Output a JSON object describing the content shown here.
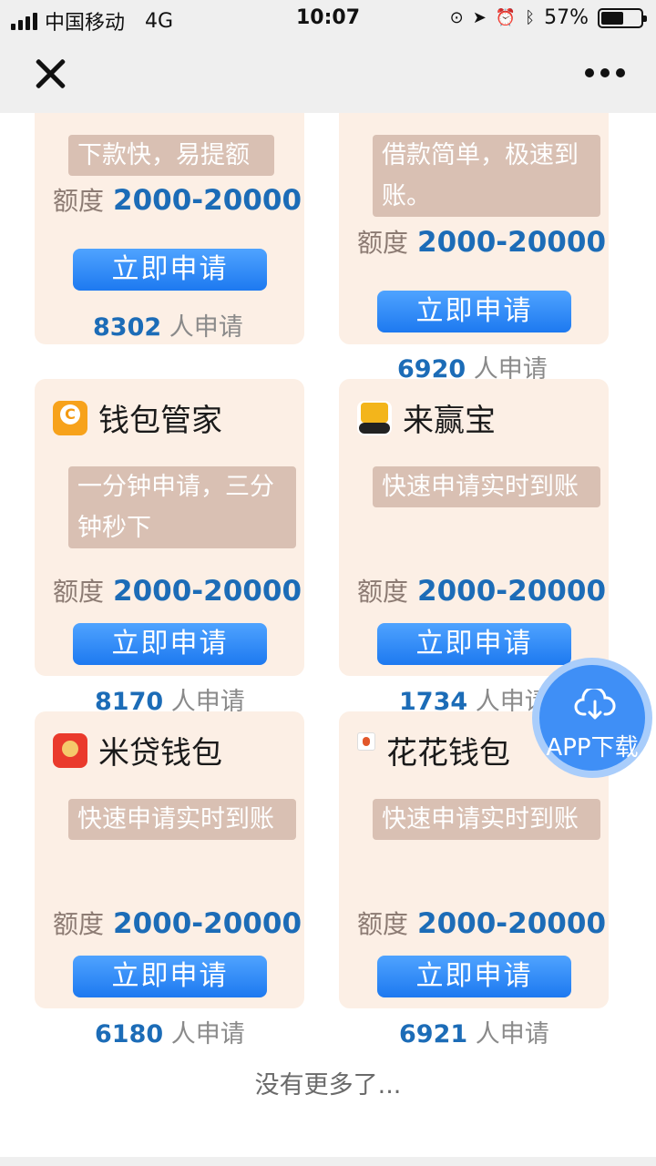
{
  "status_bar": {
    "carrier": "中国移动",
    "network": "4G",
    "time": "10:07",
    "battery_percent": "57%",
    "battery_level": 0.57,
    "icons": [
      "orientation-lock-icon",
      "location-icon",
      "alarm-icon",
      "bluetooth-icon"
    ]
  },
  "nav": {
    "close_icon": "close-icon",
    "more_icon": "more-icon"
  },
  "cards": [
    {
      "name": "",
      "desc": "下款快，易提额",
      "quota_label": "额度",
      "quota_value": "2000-20000",
      "apply_label": "立即申请",
      "count": "8302",
      "count_suffix": "人申请"
    },
    {
      "name": "",
      "desc": "借款简单，极速到账。",
      "quota_label": "额度",
      "quota_value": "2000-20000",
      "apply_label": "立即申请",
      "count": "6920",
      "count_suffix": "人申请"
    },
    {
      "name": "钱包管家",
      "desc": "一分钟申请，三分钟秒下",
      "quota_label": "额度",
      "quota_value": "2000-20000",
      "apply_label": "立即申请",
      "count": "8170",
      "count_suffix": "人申请"
    },
    {
      "name": "来赢宝",
      "desc": "快速申请实时到账",
      "quota_label": "额度",
      "quota_value": "2000-20000",
      "apply_label": "立即申请",
      "count": "1734",
      "count_suffix": "人申请"
    },
    {
      "name": "米贷钱包",
      "desc": "快速申请实时到账",
      "quota_label": "额度",
      "quota_value": "2000-20000",
      "apply_label": "立即申请",
      "count": "6180",
      "count_suffix": "人申请"
    },
    {
      "name": "花花钱包",
      "desc": "快速申请实时到账",
      "quota_label": "额度",
      "quota_value": "2000-20000",
      "apply_label": "立即申请",
      "count": "6921",
      "count_suffix": "人申请"
    }
  ],
  "footer_note": "没有更多了...",
  "download_button": {
    "label": "APP下载",
    "icon": "cloud-download-icon"
  },
  "colors": {
    "accent": "#1d79f0",
    "card_bg": "#fcefe5",
    "desc_bg": "#d9c0b3",
    "quota_value": "#1c6cb7"
  }
}
